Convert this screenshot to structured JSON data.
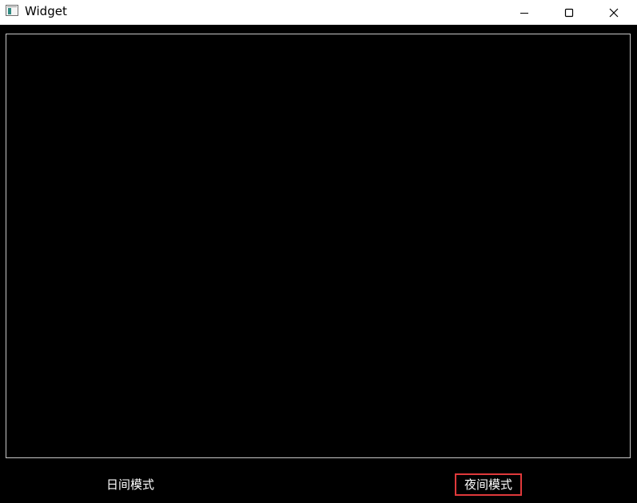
{
  "window": {
    "title": "Widget",
    "controls": {
      "minimize_icon": "minimize-icon",
      "maximize_icon": "maximize-icon",
      "close_icon": "close-icon"
    }
  },
  "buttons": {
    "day_mode_label": "日间模式",
    "night_mode_label": "夜间模式"
  },
  "colors": {
    "background": "#000000",
    "titlebar": "#ffffff",
    "panel_border": "#c8c8c8",
    "text": "#ffffff",
    "highlight": "#e0393b"
  }
}
